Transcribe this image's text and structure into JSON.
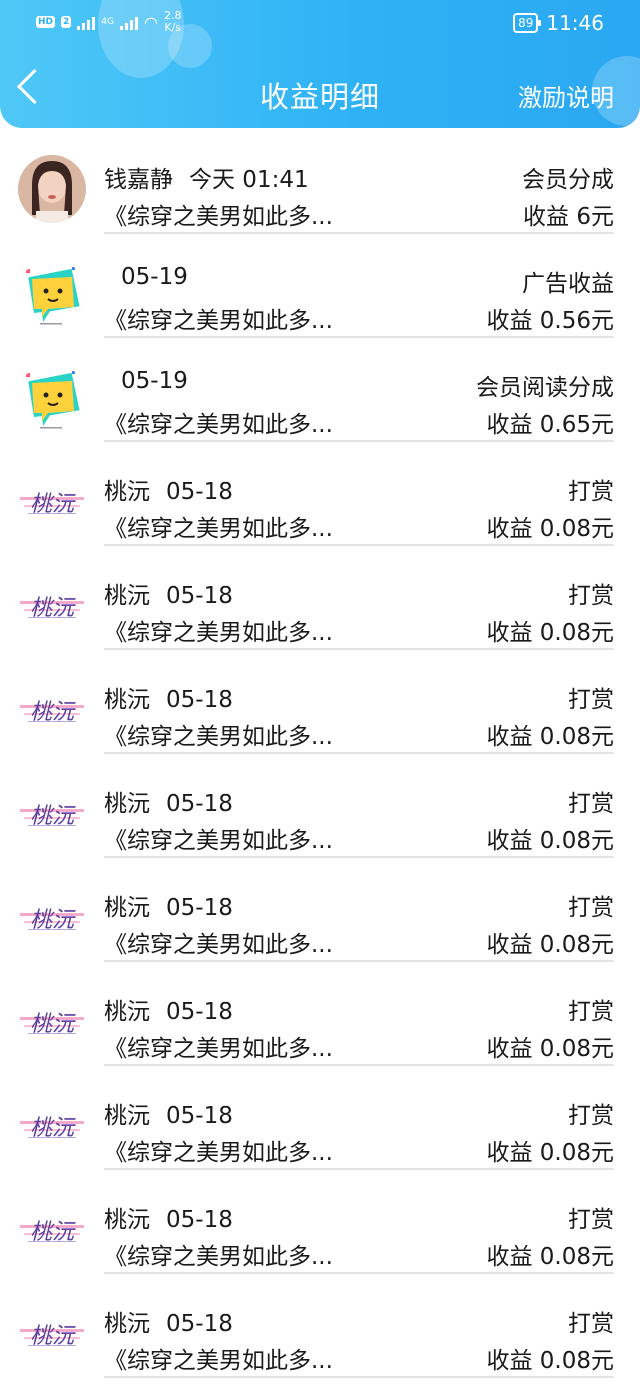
{
  "status_bar": {
    "hd_badge": "HD",
    "sim_badge": "2",
    "network_type": "4G",
    "speed_value": "2.8",
    "speed_unit": "K/s",
    "battery": "89",
    "time": "11:46"
  },
  "header": {
    "title": "收益明细",
    "right_link": "激励说明",
    "background_color": "#2fb2f5"
  },
  "entries": [
    {
      "avatar": "photo",
      "name": "钱嘉静",
      "time": "今天 01:41",
      "type": "会员分成",
      "book": "《综穿之美男如此多...",
      "amount": "收益 6元"
    },
    {
      "avatar": "chat-bubble",
      "name": "",
      "time": "05-19",
      "type": "广告收益",
      "book": "《综穿之美男如此多...",
      "amount": "收益 0.56元"
    },
    {
      "avatar": "chat-bubble",
      "name": "",
      "time": "05-19",
      "type": "会员阅读分成",
      "book": "《综穿之美男如此多...",
      "amount": "收益 0.65元"
    },
    {
      "avatar": "taoyuan-logo",
      "name": "桃沅",
      "time": "05-18",
      "type": "打赏",
      "book": "《综穿之美男如此多...",
      "amount": "收益 0.08元"
    },
    {
      "avatar": "taoyuan-logo",
      "name": "桃沅",
      "time": "05-18",
      "type": "打赏",
      "book": "《综穿之美男如此多...",
      "amount": "收益 0.08元"
    },
    {
      "avatar": "taoyuan-logo",
      "name": "桃沅",
      "time": "05-18",
      "type": "打赏",
      "book": "《综穿之美男如此多...",
      "amount": "收益 0.08元"
    },
    {
      "avatar": "taoyuan-logo",
      "name": "桃沅",
      "time": "05-18",
      "type": "打赏",
      "book": "《综穿之美男如此多...",
      "amount": "收益 0.08元"
    },
    {
      "avatar": "taoyuan-logo",
      "name": "桃沅",
      "time": "05-18",
      "type": "打赏",
      "book": "《综穿之美男如此多...",
      "amount": "收益 0.08元"
    },
    {
      "avatar": "taoyuan-logo",
      "name": "桃沅",
      "time": "05-18",
      "type": "打赏",
      "book": "《综穿之美男如此多...",
      "amount": "收益 0.08元"
    },
    {
      "avatar": "taoyuan-logo",
      "name": "桃沅",
      "time": "05-18",
      "type": "打赏",
      "book": "《综穿之美男如此多...",
      "amount": "收益 0.08元"
    },
    {
      "avatar": "taoyuan-logo",
      "name": "桃沅",
      "time": "05-18",
      "type": "打赏",
      "book": "《综穿之美男如此多...",
      "amount": "收益 0.08元"
    },
    {
      "avatar": "taoyuan-logo",
      "name": "桃沅",
      "time": "05-18",
      "type": "打赏",
      "book": "《综穿之美男如此多...",
      "amount": "收益 0.08元"
    }
  ]
}
